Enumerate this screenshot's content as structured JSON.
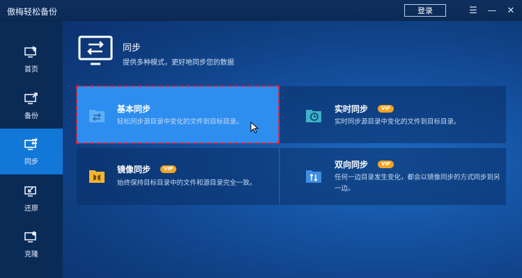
{
  "app": {
    "title": "傲梅轻松备份",
    "login": "登录"
  },
  "window": {
    "menu_glyph": "☰",
    "minimize_glyph": "—",
    "close_glyph": "✕"
  },
  "sidebar": {
    "items": [
      {
        "label": "首页",
        "icon": "home-monitor-icon",
        "active": false
      },
      {
        "label": "备份",
        "icon": "backup-icon",
        "active": false
      },
      {
        "label": "同步",
        "icon": "sync-icon",
        "active": true
      },
      {
        "label": "还原",
        "icon": "restore-icon",
        "active": false
      },
      {
        "label": "克隆",
        "icon": "clone-icon",
        "active": false
      }
    ]
  },
  "header": {
    "title": "同步",
    "desc": "提供多种模式，更好地同步您的数据"
  },
  "cards": [
    {
      "title": "基本同步",
      "desc": "轻松同步源目录中变化的文件到目标目录。",
      "vip": "",
      "icon": "basic-sync-folder-icon"
    },
    {
      "title": "实时同步",
      "desc": "实时同步源目录中变化的文件到目标目录。",
      "vip": "VIP",
      "icon": "realtime-sync-folder-icon"
    },
    {
      "title": "镜像同步",
      "desc": "始终保持目标目录中的文件和源目录完全一致。",
      "vip": "VIP",
      "icon": "mirror-sync-folder-icon"
    },
    {
      "title": "双向同步",
      "desc": "任何一边目录发生变化，都会以镜像同步的方式同步到另一边。",
      "vip": "VIP",
      "icon": "two-way-sync-folder-icon"
    }
  ],
  "colors": {
    "accent": "#1178d8",
    "selected_card": "#2d8ef0",
    "selection_border": "#e0213a",
    "vip": "#f0a426",
    "folder_teal": "#3bb3c8",
    "folder_yellow": "#f1b533",
    "folder_blue": "#3f8ee0"
  }
}
